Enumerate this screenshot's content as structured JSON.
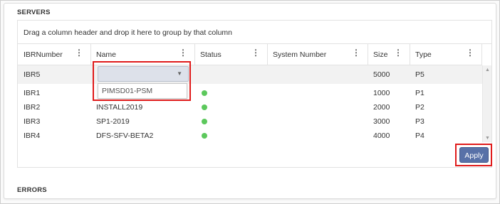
{
  "sections": {
    "servers_title": "SERVERS",
    "errors_title": "ERRORS"
  },
  "grid": {
    "group_hint": "Drag a column header and drop it here to group by that column",
    "columns": [
      {
        "label": "IBRNumber"
      },
      {
        "label": "Name"
      },
      {
        "label": "Status"
      },
      {
        "label": "System Number"
      },
      {
        "label": "Size"
      },
      {
        "label": "Type"
      }
    ],
    "rows": [
      {
        "ibr": "IBR5",
        "name": "",
        "status": "",
        "system": "",
        "size": "5000",
        "type": "P5",
        "editing": true
      },
      {
        "ibr": "IBR1",
        "name": "",
        "status": "online",
        "system": "",
        "size": "1000",
        "type": "P1"
      },
      {
        "ibr": "IBR2",
        "name": "INSTALL2019",
        "status": "online",
        "system": "",
        "size": "2000",
        "type": "P2"
      },
      {
        "ibr": "IBR3",
        "name": "SP1-2019",
        "status": "online",
        "system": "",
        "size": "3000",
        "type": "P3"
      },
      {
        "ibr": "IBR4",
        "name": "DFS-SFV-BETA2",
        "status": "online",
        "system": "",
        "size": "4000",
        "type": "P4"
      }
    ],
    "status_color": "#5cc85c"
  },
  "dropdown": {
    "selected": "",
    "options": [
      "PIMSD01-PSM"
    ]
  },
  "apply_label": "Apply",
  "colors": {
    "highlight": "#e01b1b",
    "apply_button": "#5871a8"
  },
  "icons": {
    "column_menu": "vertical-ellipsis-icon",
    "dropdown_caret": "caret-down-icon",
    "scroll_up": "scroll-up-arrow-icon",
    "scroll_down": "scroll-down-arrow-icon"
  }
}
